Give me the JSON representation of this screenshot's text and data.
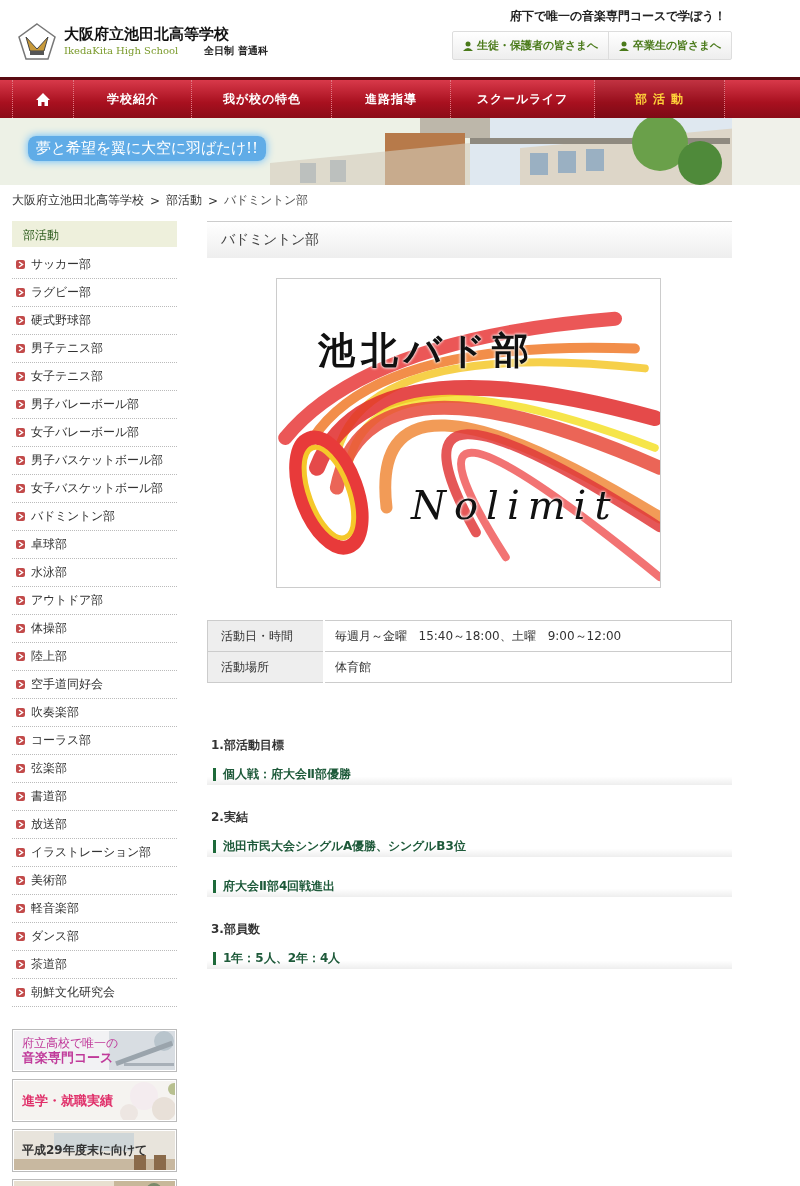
{
  "header": {
    "school_name": "大阪府立池田北高等学校",
    "school_name_en": "IkedaKita High School",
    "course_type": "全日制 普通科",
    "tagline": "府下で唯一の音楽専門コースで学ぼう！",
    "audience_links": [
      {
        "label": "生徒・保護者の皆さまへ"
      },
      {
        "label": "卒業生の皆さまへ"
      }
    ]
  },
  "nav": [
    {
      "kind": "home",
      "selected": false
    },
    {
      "kind": "text",
      "label": "学校紹介",
      "selected": false
    },
    {
      "kind": "text",
      "label": "我が校の特色",
      "selected": false
    },
    {
      "kind": "text",
      "label": "進路指導",
      "selected": false
    },
    {
      "kind": "text",
      "label": "スクールライフ",
      "selected": false
    },
    {
      "kind": "text",
      "label": "部 活 動",
      "selected": true
    }
  ],
  "hero": {
    "slogan": "夢と希望を翼に大空に羽ばたけ!!",
    "kind": "picture"
  },
  "breadcrumb": [
    {
      "kind": "link",
      "text": "大阪府立池田北高等学校"
    },
    {
      "kind": "separator",
      "text": ">"
    },
    {
      "kind": "link",
      "text": "部活動"
    },
    {
      "kind": "separator",
      "text": ">"
    },
    {
      "kind": "current",
      "text": "バドミントン部"
    }
  ],
  "sidebar": {
    "heading": "部活動",
    "items": [
      {
        "label": "サッカー部",
        "selected": false
      },
      {
        "label": "ラグビー部",
        "selected": false
      },
      {
        "label": "硬式野球部",
        "selected": false
      },
      {
        "label": "男子テニス部",
        "selected": false
      },
      {
        "label": "女子テニス部",
        "selected": false
      },
      {
        "label": "男子バレーボール部",
        "selected": false
      },
      {
        "label": "女子バレーボール部",
        "selected": false
      },
      {
        "label": "男子バスケットボール部",
        "selected": false
      },
      {
        "label": "女子バスケットボール部",
        "selected": false
      },
      {
        "label": "バドミントン部",
        "selected": false
      },
      {
        "label": "卓球部",
        "selected": false
      },
      {
        "label": "水泳部",
        "selected": false
      },
      {
        "label": "アウトドア部",
        "selected": false
      },
      {
        "label": "体操部",
        "selected": false
      },
      {
        "label": "陸上部",
        "selected": false
      },
      {
        "label": "空手道同好会",
        "selected": false
      },
      {
        "label": "吹奏楽部",
        "selected": false
      },
      {
        "label": "コーラス部",
        "selected": false
      },
      {
        "label": "弦楽部",
        "selected": false
      },
      {
        "label": "書道部",
        "selected": false
      },
      {
        "label": "放送部",
        "selected": false
      },
      {
        "label": "イラストレーション部",
        "selected": false
      },
      {
        "label": "美術部",
        "selected": false
      },
      {
        "label": "軽音楽部",
        "selected": false
      },
      {
        "label": "ダンス部",
        "selected": false
      },
      {
        "label": "茶道部",
        "selected": false
      },
      {
        "label": "朝鮮文化研究会",
        "selected": false
      }
    ],
    "banners": [
      {
        "lines": [
          "府立高校で唯一の",
          "音楽専門コース"
        ],
        "kind": "music"
      },
      {
        "lines": [
          "進学・就職実績"
        ],
        "kind": "blossom"
      },
      {
        "lines": [
          "平成29年度末に向けて"
        ],
        "kind": "classroom"
      },
      {
        "kind": "stage"
      }
    ]
  },
  "main": {
    "title": "バドミントン部",
    "club_logo": {
      "title": "池北バド部",
      "motto": "Nolimit"
    },
    "info_table": [
      {
        "label": "活動日・時間",
        "value": "毎週月～金曜　15:40～18:00、土曜　9:00～12:00"
      },
      {
        "label": "活動場所",
        "value": "体育館"
      }
    ],
    "sections": [
      {
        "heading": "1.部活動目標",
        "items": [
          "個人戦：府大会Ⅱ部優勝"
        ]
      },
      {
        "heading": "2.実結",
        "items": [
          "池田市民大会シングルA優勝、シングルB3位",
          "府大会Ⅱ部4回戦進出"
        ]
      },
      {
        "heading": "3.部員数",
        "items": [
          "1年：5人、2年：4人"
        ]
      }
    ]
  }
}
